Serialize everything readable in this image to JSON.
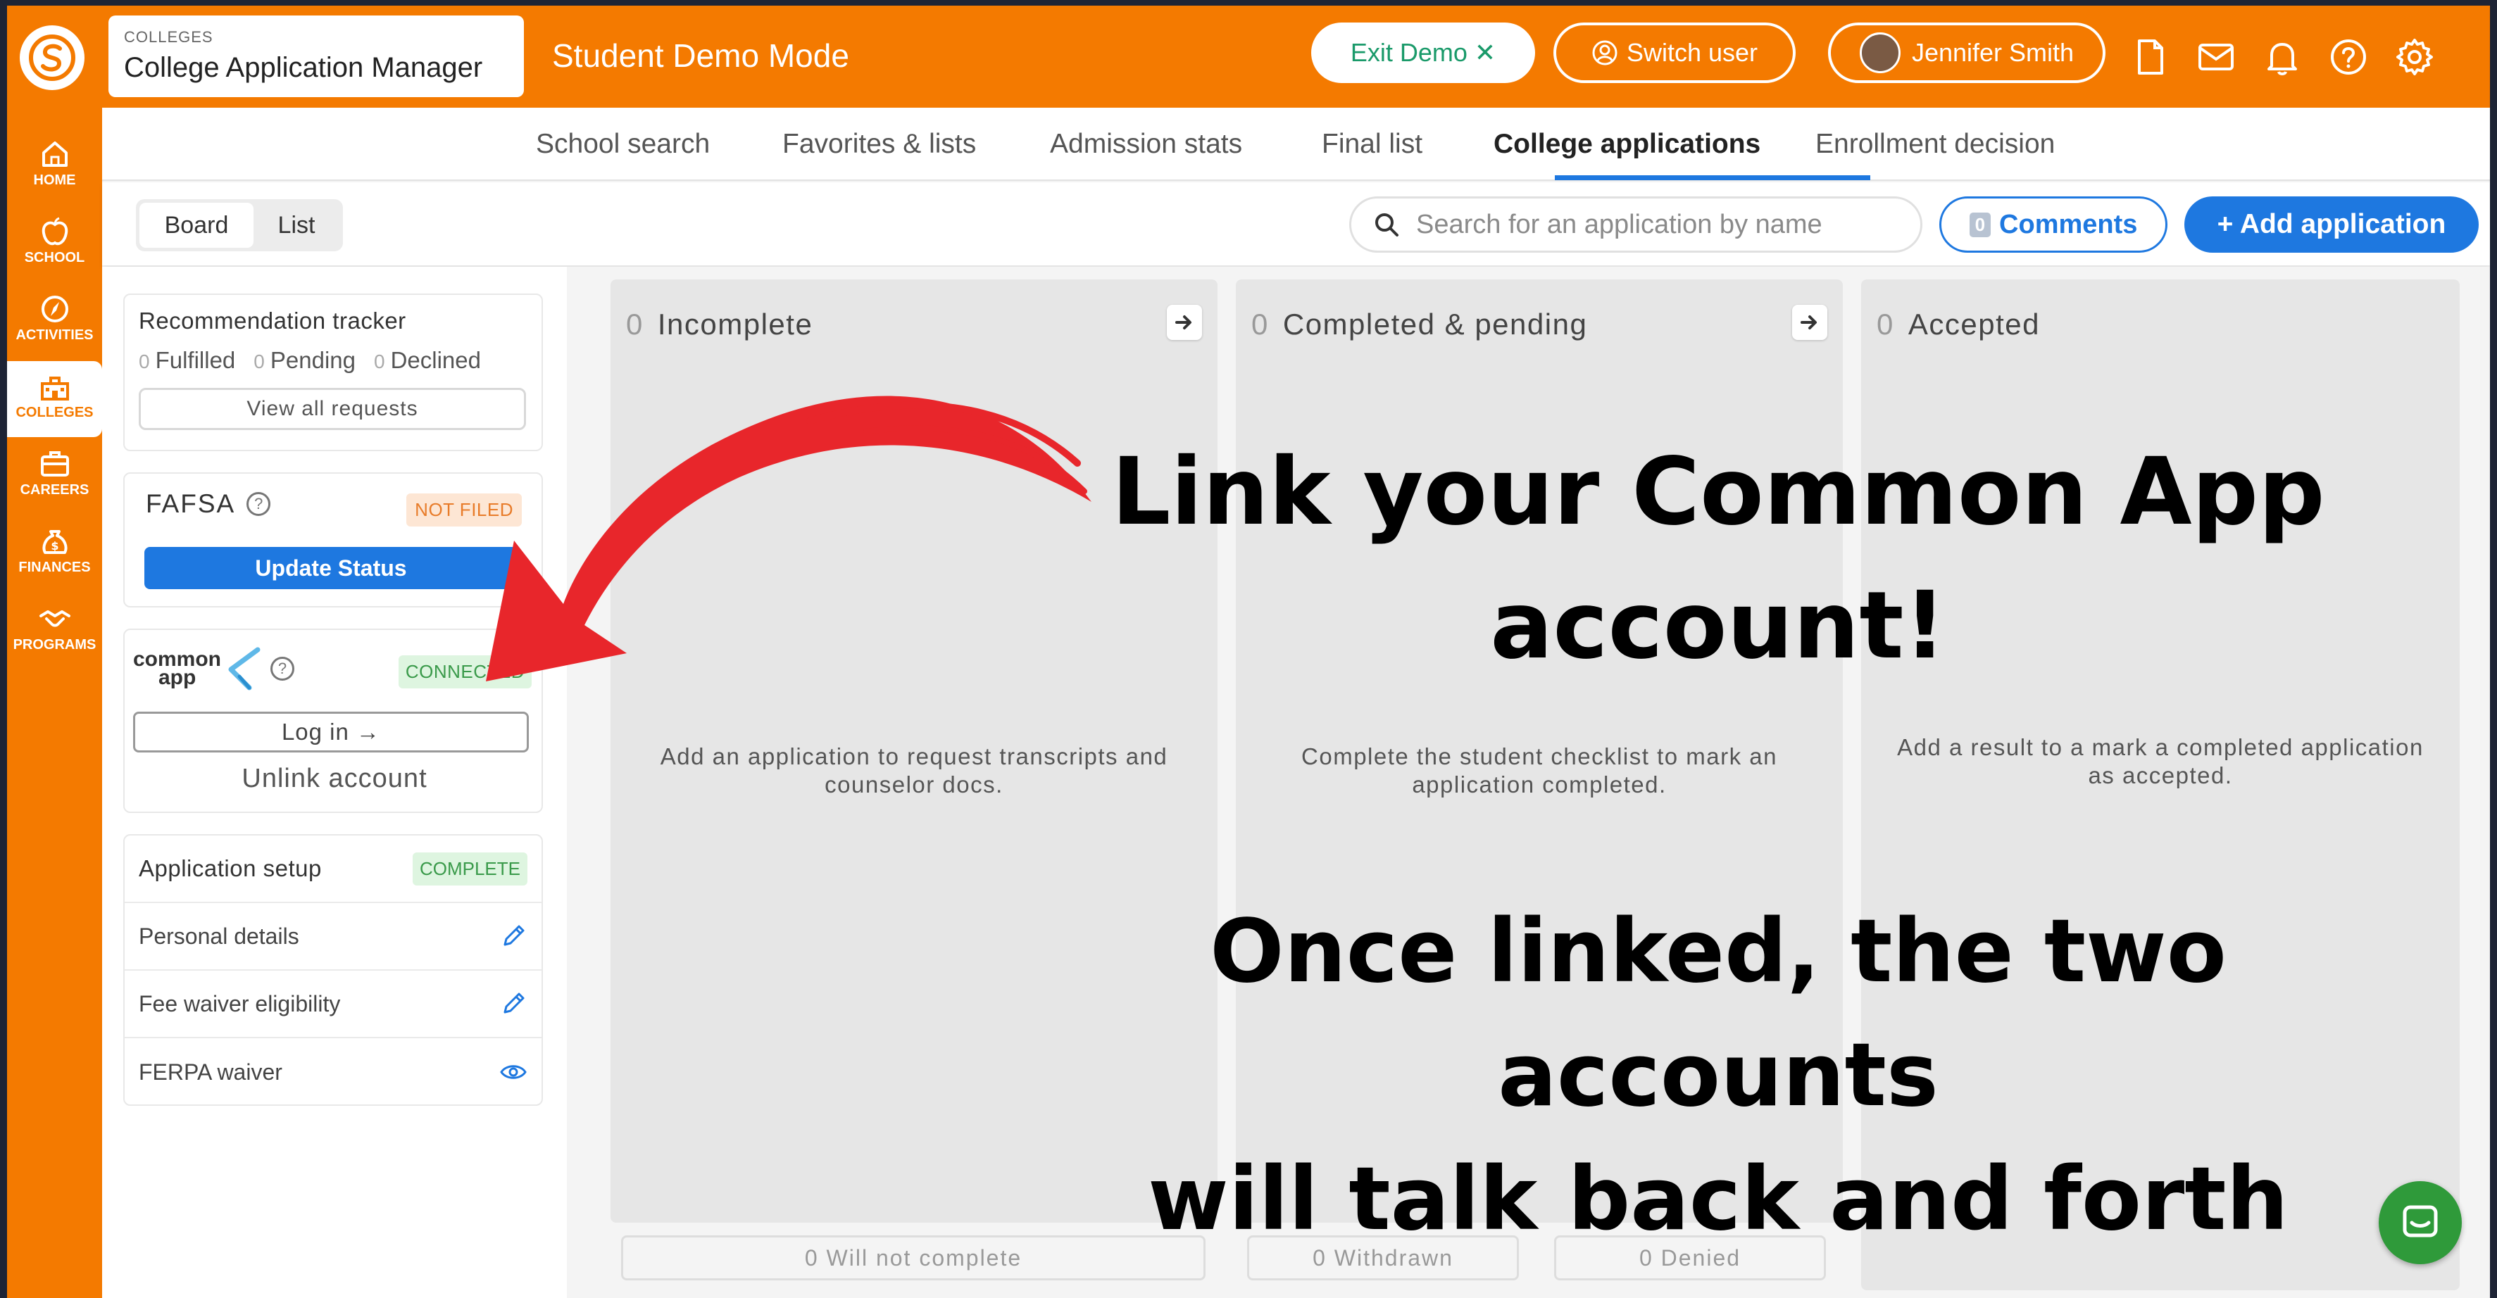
{
  "topbar": {
    "app_category": "COLLEGES",
    "app_title": "College Application Manager",
    "mode_label": "Student Demo Mode",
    "exit_demo": "Exit Demo ✕",
    "switch_user": "Switch user",
    "user_name": "Jennifer Smith",
    "brand_color": "#f47a00",
    "icons": [
      "document-icon",
      "mail-icon",
      "bell-icon",
      "help-icon",
      "gear-icon"
    ]
  },
  "nav": [
    {
      "label": "HOME",
      "icon": "home-icon"
    },
    {
      "label": "SCHOOL",
      "icon": "apple-icon"
    },
    {
      "label": "ACTIVITIES",
      "icon": "compass-icon"
    },
    {
      "label": "COLLEGES",
      "icon": "college-icon",
      "active": true
    },
    {
      "label": "CAREERS",
      "icon": "briefcase-icon"
    },
    {
      "label": "FINANCES",
      "icon": "money-bag-icon"
    },
    {
      "label": "PROGRAMS",
      "icon": "handshake-icon"
    }
  ],
  "tabs": [
    "School search",
    "Favorites & lists",
    "Admission stats",
    "Final list",
    "College applications",
    "Enrollment decision"
  ],
  "toolbar": {
    "board": "Board",
    "list": "List",
    "search_placeholder": "Search for an application by name",
    "comments_count": "0",
    "comments": "Comments",
    "add_application": "+ Add application"
  },
  "sidebar": {
    "rec_tracker": {
      "title": "Recommendation tracker",
      "fulfilled_count": "0",
      "fulfilled": "Fulfilled",
      "pending_count": "0",
      "pending": "Pending",
      "declined_count": "0",
      "declined": "Declined",
      "view_all": "View all requests"
    },
    "fafsa": {
      "title": "FAFSA",
      "status": "NOT FILED",
      "update": "Update Status"
    },
    "common_app": {
      "logo_word_1": "common",
      "logo_word_2": "app",
      "status": "CONNECTED",
      "login": "Log in →",
      "unlink": "Unlink account"
    },
    "setup": {
      "title": "Application setup",
      "status": "COMPLETE",
      "rows": [
        {
          "label": "Personal details",
          "icon": "pencil-icon"
        },
        {
          "label": "Fee waiver eligibility",
          "icon": "pencil-icon"
        },
        {
          "label": "FERPA waiver",
          "icon": "eye-icon"
        }
      ]
    }
  },
  "board": {
    "columns": [
      {
        "count": "0",
        "title": "Incomplete",
        "empty": "Add an application to request transcripts and counselor docs."
      },
      {
        "count": "0",
        "title": "Completed & pending",
        "empty": "Complete the student checklist to mark an application completed."
      },
      {
        "count": "0",
        "title": "Accepted",
        "empty": "Add a result to a mark a completed application as accepted."
      }
    ],
    "footer": {
      "will_not_complete": "0  Will not complete",
      "withdrawn": "0  Withdrawn",
      "denied": "0  Denied"
    }
  },
  "overlay": {
    "line1": "Link your Common App",
    "line2": "account!",
    "line3": "Once linked, the two accounts",
    "line4": "will talk back and forth",
    "arrow_color": "#e8262b"
  }
}
